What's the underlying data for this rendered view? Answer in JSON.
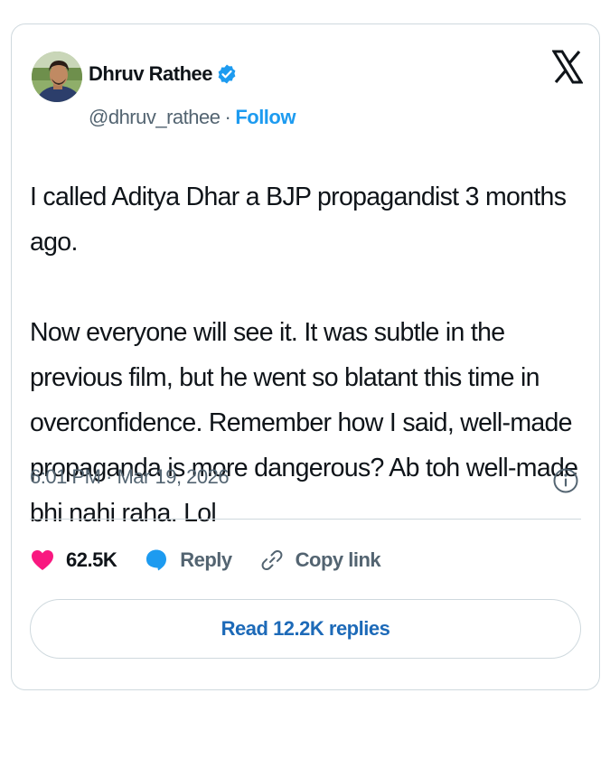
{
  "author": {
    "name": "Dhruv Rathee",
    "handle": "@dhruv_rathee",
    "separator": "·",
    "follow_label": "Follow",
    "verified_color": "#1d9bf0"
  },
  "tweet": {
    "paragraphs": [
      "I called Aditya Dhar a BJP propagandist 3 months ago.",
      "Now everyone will see it. It was subtle in the previous film, but he went so blatant this time in overconfidence. Remember how I said, well-made propaganda is more dangerous? Ab toh well-made bhi nahi raha. Lol"
    ],
    "timestamp": "6:01 PM · Mar 19, 2026"
  },
  "actions": {
    "likes": "62.5K",
    "reply_label": "Reply",
    "copy_link_label": "Copy link"
  },
  "read_replies_label": "Read 12.2K replies",
  "colors": {
    "like": "#f91880",
    "reply": "#1d9bf0",
    "link_text": "#1d6ab8"
  },
  "icons": [
    "x-logo-icon",
    "verified-badge-icon",
    "info-icon",
    "heart-icon",
    "reply-bubble-icon",
    "link-icon"
  ]
}
